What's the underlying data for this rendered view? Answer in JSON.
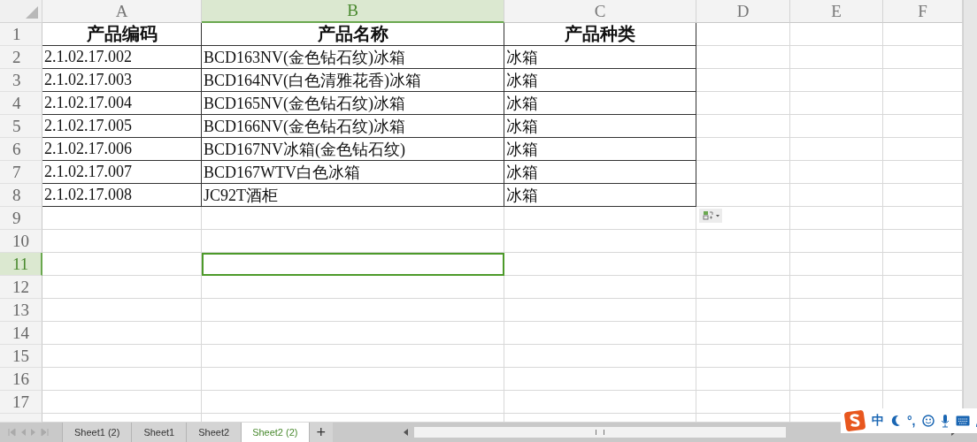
{
  "columns": [
    {
      "label": "A",
      "selected": false
    },
    {
      "label": "B",
      "selected": true
    },
    {
      "label": "C",
      "selected": false
    },
    {
      "label": "D",
      "selected": false
    },
    {
      "label": "E",
      "selected": false
    },
    {
      "label": "F",
      "selected": false
    }
  ],
  "rows": [
    {
      "number": "1",
      "selected": false,
      "kind": "heading",
      "cells": [
        "产品编码",
        "产品名称",
        "产品种类"
      ]
    },
    {
      "number": "2",
      "selected": false,
      "kind": "data",
      "cells": [
        "2.1.02.17.002",
        "BCD163NV(金色钻石纹)冰箱",
        "冰箱"
      ]
    },
    {
      "number": "3",
      "selected": false,
      "kind": "data",
      "cells": [
        "2.1.02.17.003",
        "BCD164NV(白色清雅花香)冰箱",
        "冰箱"
      ]
    },
    {
      "number": "4",
      "selected": false,
      "kind": "data",
      "cells": [
        "2.1.02.17.004",
        "BCD165NV(金色钻石纹)冰箱",
        "冰箱"
      ]
    },
    {
      "number": "5",
      "selected": false,
      "kind": "data",
      "cells": [
        "2.1.02.17.005",
        "BCD166NV(金色钻石纹)冰箱",
        "冰箱"
      ]
    },
    {
      "number": "6",
      "selected": false,
      "kind": "data",
      "cells": [
        "2.1.02.17.006",
        "BCD167NV冰箱(金色钻石纹)",
        "冰箱"
      ]
    },
    {
      "number": "7",
      "selected": false,
      "kind": "data",
      "cells": [
        "2.1.02.17.007",
        "BCD167WTV白色冰箱",
        "冰箱"
      ]
    },
    {
      "number": "8",
      "selected": false,
      "kind": "data",
      "cells": [
        "2.1.02.17.008",
        "JC92T酒柜",
        "冰箱"
      ]
    },
    {
      "number": "9",
      "selected": false
    },
    {
      "number": "10",
      "selected": false
    },
    {
      "number": "11",
      "selected": true
    },
    {
      "number": "12",
      "selected": false
    },
    {
      "number": "13",
      "selected": false
    },
    {
      "number": "14",
      "selected": false
    },
    {
      "number": "15",
      "selected": false
    },
    {
      "number": "16",
      "selected": false
    },
    {
      "number": "17",
      "selected": false
    }
  ],
  "sheet_tabs": [
    {
      "label": "Sheet1 (2)",
      "selected": false
    },
    {
      "label": "Sheet1",
      "selected": false
    },
    {
      "label": "Sheet2",
      "selected": false
    },
    {
      "label": "Sheet2 (2)",
      "selected": true
    }
  ],
  "add_sheet": "+",
  "ime_toolbar": {
    "language": "中",
    "punctuation": "°,"
  }
}
